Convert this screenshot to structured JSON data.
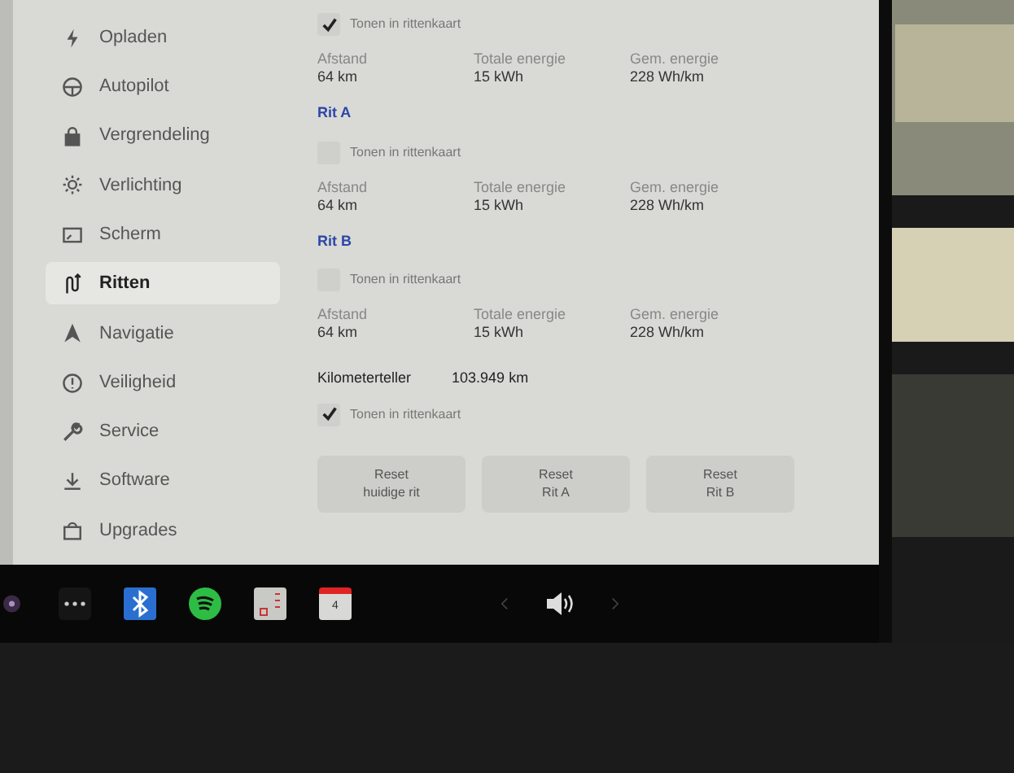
{
  "sidebar": {
    "items": [
      {
        "label": "Opladen",
        "selected": false
      },
      {
        "label": "Autopilot",
        "selected": false
      },
      {
        "label": "Vergrendeling",
        "selected": false
      },
      {
        "label": "Verlichting",
        "selected": false
      },
      {
        "label": "Scherm",
        "selected": false
      },
      {
        "label": "Ritten",
        "selected": true
      },
      {
        "label": "Navigatie",
        "selected": false
      },
      {
        "label": "Veiligheid",
        "selected": false
      },
      {
        "label": "Service",
        "selected": false
      },
      {
        "label": "Software",
        "selected": false
      },
      {
        "label": "Upgrades",
        "selected": false
      }
    ]
  },
  "trips": [
    {
      "show_on_map": {
        "label": "Tonen in rittenkaart",
        "checked": true
      },
      "stats": [
        {
          "label": "Afstand",
          "value": "64 km"
        },
        {
          "label": "Totale energie",
          "value": "15 kWh"
        },
        {
          "label": "Gem. energie",
          "value": "228 Wh/km"
        }
      ]
    },
    {
      "heading": "Rit A",
      "show_on_map": {
        "label": "Tonen in rittenkaart",
        "checked": false
      },
      "stats": [
        {
          "label": "Afstand",
          "value": "64 km"
        },
        {
          "label": "Totale energie",
          "value": "15 kWh"
        },
        {
          "label": "Gem. energie",
          "value": "228 Wh/km"
        }
      ]
    },
    {
      "heading": "Rit B",
      "show_on_map": {
        "label": "Tonen in rittenkaart",
        "checked": false
      },
      "stats": [
        {
          "label": "Afstand",
          "value": "64 km"
        },
        {
          "label": "Totale energie",
          "value": "15 kWh"
        },
        {
          "label": "Gem. energie",
          "value": "228 Wh/km"
        }
      ]
    }
  ],
  "odometer": {
    "label": "Kilometerteller",
    "value": "103.949 km",
    "show_on_map": {
      "label": "Tonen in rittenkaart",
      "checked": true
    }
  },
  "buttons": [
    "Reset\nhuidige rit",
    "Reset\nRit A",
    "Reset\nRit B"
  ],
  "taskbar": {
    "calendar_day": "4"
  }
}
